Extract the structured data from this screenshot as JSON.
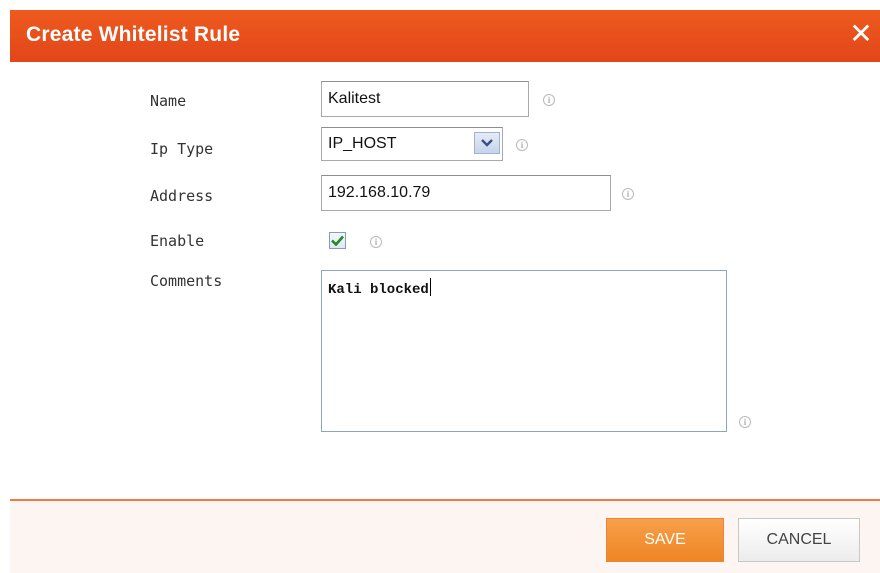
{
  "dialog": {
    "title": "Create Whitelist Rule",
    "close_symbol": "✕",
    "header_color": "#e8501c"
  },
  "form": {
    "name": {
      "label": "Name",
      "value": "Kalitest",
      "info_icon": "info-icon"
    },
    "ip_type": {
      "label": "Ip Type",
      "selected": "IP_HOST",
      "info_icon": "info-icon"
    },
    "address": {
      "label": "Address",
      "value": "192.168.10.79",
      "info_icon": "info-icon"
    },
    "enable": {
      "label": "Enable",
      "checked": true,
      "info_icon": "info-icon"
    },
    "comments": {
      "label": "Comments",
      "value": "Kali blocked",
      "info_icon": "info-icon"
    }
  },
  "footer": {
    "save_label": "SAVE",
    "cancel_label": "CANCEL",
    "save_color": "#f28c2c"
  }
}
